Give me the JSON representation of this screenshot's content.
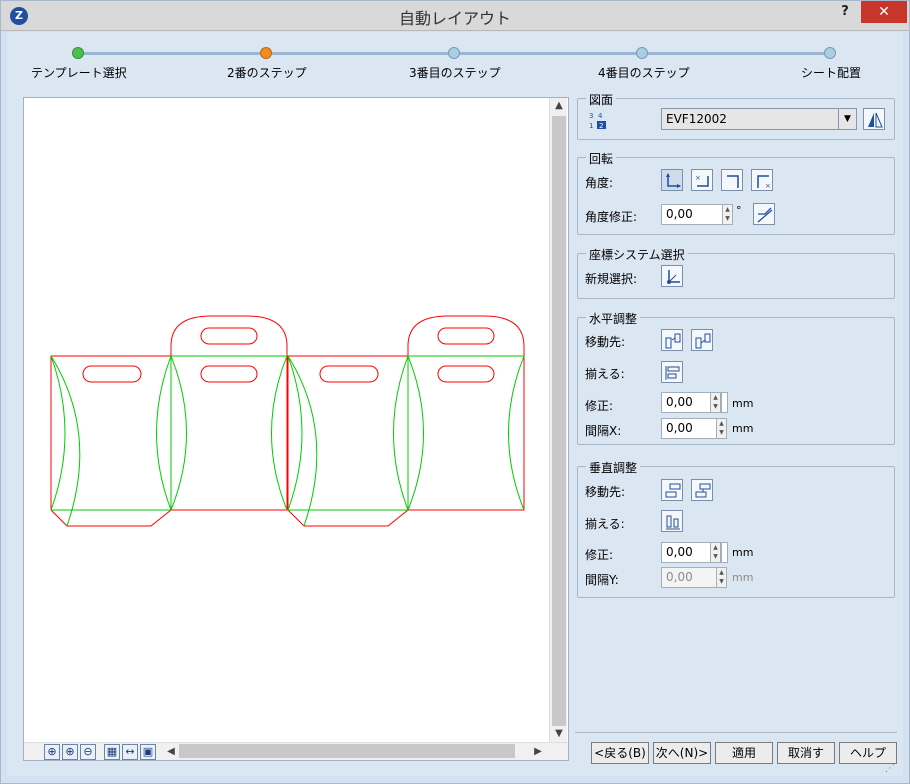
{
  "window": {
    "title": "自動レイアウト",
    "app_icon_letter": "Z",
    "help_label": "?",
    "close_label": "✕"
  },
  "steps": [
    {
      "label": "テンプレート選択",
      "state": "done",
      "color": "#4cbf4c"
    },
    {
      "label": "2番のステップ",
      "state": "current",
      "color": "#f28c1e"
    },
    {
      "label": "3番目のステップ",
      "state": "todo",
      "color": "#a8cfe6"
    },
    {
      "label": "4番目のステップ",
      "state": "todo",
      "color": "#a8cfe6"
    },
    {
      "label": "シート配置",
      "state": "todo",
      "color": "#a8cfe6"
    }
  ],
  "drawing": {
    "title": "図面",
    "selected": "EVF12002",
    "icon": "sheet-number-icon"
  },
  "rotation": {
    "title": "回転",
    "angle_label": "角度:",
    "correction_label": "角度修正:",
    "correction_value": "0,00",
    "correction_unit": "°"
  },
  "coord_system": {
    "title": "座標システム選択",
    "new_label": "新規選択:"
  },
  "horizontal": {
    "title": "水平調整",
    "move_label": "移動先:",
    "align_label": "揃える:",
    "correction_label": "修正:",
    "correction_value": "0,00",
    "gap_label": "間隔X:",
    "gap_value": "0,00",
    "unit": "mm"
  },
  "vertical": {
    "title": "垂直調整",
    "move_label": "移動先:",
    "align_label": "揃える:",
    "correction_label": "修正:",
    "correction_value": "0,00",
    "gap_label": "間隔Y:",
    "gap_value": "0,00",
    "unit": "mm"
  },
  "buttons": {
    "back": "<戻る(B)",
    "next": "次へ(N)>",
    "apply": "適用",
    "cancel": "取消す",
    "help": "ヘルプ"
  },
  "colors": {
    "cut_line": "#ff0000",
    "crease_line": "#00cc00",
    "accent": "#1f4f9e"
  }
}
